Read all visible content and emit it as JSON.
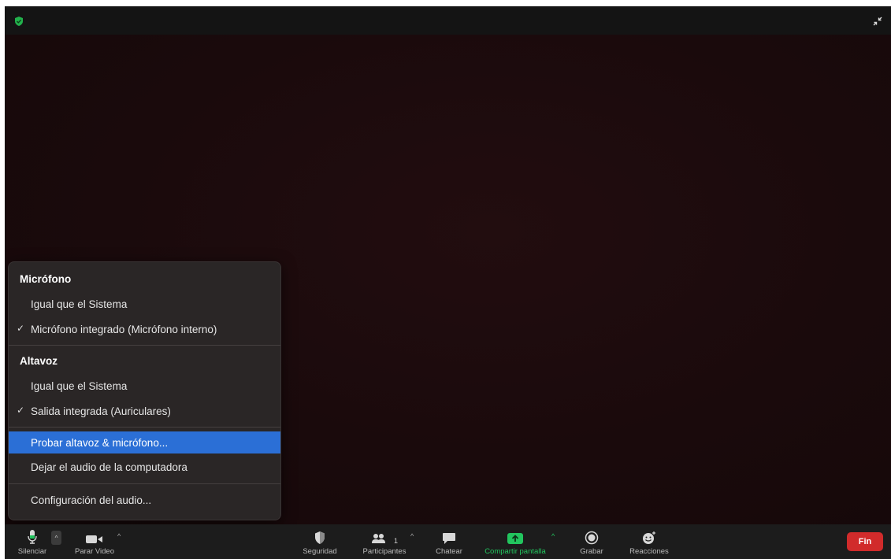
{
  "menu": {
    "mic_header": "Micrófono",
    "mic_items": [
      {
        "label": "Igual que el Sistema",
        "checked": false
      },
      {
        "label": "Micrófono integrado (Micrófono interno)",
        "checked": true
      }
    ],
    "speaker_header": "Altavoz",
    "speaker_items": [
      {
        "label": "Igual que el Sistema",
        "checked": false
      },
      {
        "label": "Salida integrada (Auriculares)",
        "checked": true
      }
    ],
    "actions": [
      {
        "label": "Probar altavoz & micrófono...",
        "highlighted": true
      },
      {
        "label": "Dejar el audio de la computadora",
        "highlighted": false
      }
    ],
    "settings": "Configuración del audio...",
    "check_glyph": "✓"
  },
  "toolbar": {
    "mute_label": "Silenciar",
    "video_label": "Parar Video",
    "security_label": "Seguridad",
    "participants_label": "Participantes",
    "participants_count": "1",
    "chat_label": "Chatear",
    "share_label": "Compartir pantalla",
    "record_label": "Grabar",
    "reactions_label": "Reacciones",
    "end_label": "Fin"
  },
  "colors": {
    "share_green": "#22c55e",
    "end_red": "#d12b2b",
    "highlight_blue": "#2b6fd6",
    "shield_green": "#22b14c"
  },
  "icons": {
    "top_left": "shield-check-icon",
    "top_right": "exit-fullscreen-icon"
  }
}
